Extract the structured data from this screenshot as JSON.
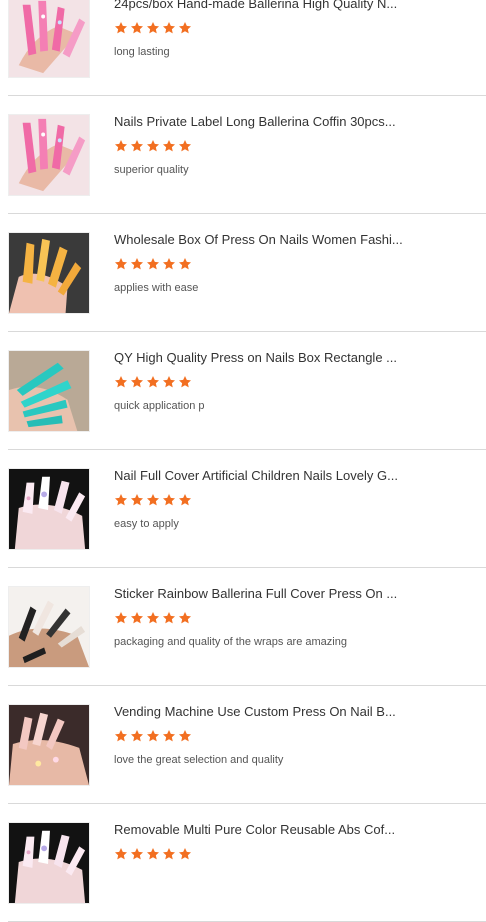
{
  "accent_color": "#f26f21",
  "star_icon": "star-icon",
  "products": [
    {
      "title": "24pcs/box Hand-made Ballerina High Quality N...",
      "rating": 5,
      "review": "long lasting",
      "thumb_style": "pink"
    },
    {
      "title": "Nails Private Label Long Ballerina Coffin 30pcs...",
      "rating": 5,
      "review": "superior quality",
      "thumb_style": "pink"
    },
    {
      "title": "Wholesale Box Of Press On Nails Women Fashi...",
      "rating": 5,
      "review": "applies with ease",
      "thumb_style": "yellow"
    },
    {
      "title": "QY High Quality Press on Nails Box Rectangle ...",
      "rating": 5,
      "review": "quick application p",
      "thumb_style": "teal"
    },
    {
      "title": "Nail Full Cover Artificial Children Nails Lovely G...",
      "rating": 5,
      "review": "easy to apply",
      "thumb_style": "dark"
    },
    {
      "title": "Sticker Rainbow Ballerina Full Cover Press On ...",
      "rating": 5,
      "review": "packaging and quality of the wraps are amazing",
      "thumb_style": "patterned"
    },
    {
      "title": "Vending Machine Use Custom Press On Nail B...",
      "rating": 5,
      "review": "love the great selection and quality",
      "thumb_style": "nude"
    },
    {
      "title": "Removable Multi Pure Color Reusable Abs Cof...",
      "rating": 5,
      "review": "",
      "thumb_style": "dark"
    }
  ]
}
